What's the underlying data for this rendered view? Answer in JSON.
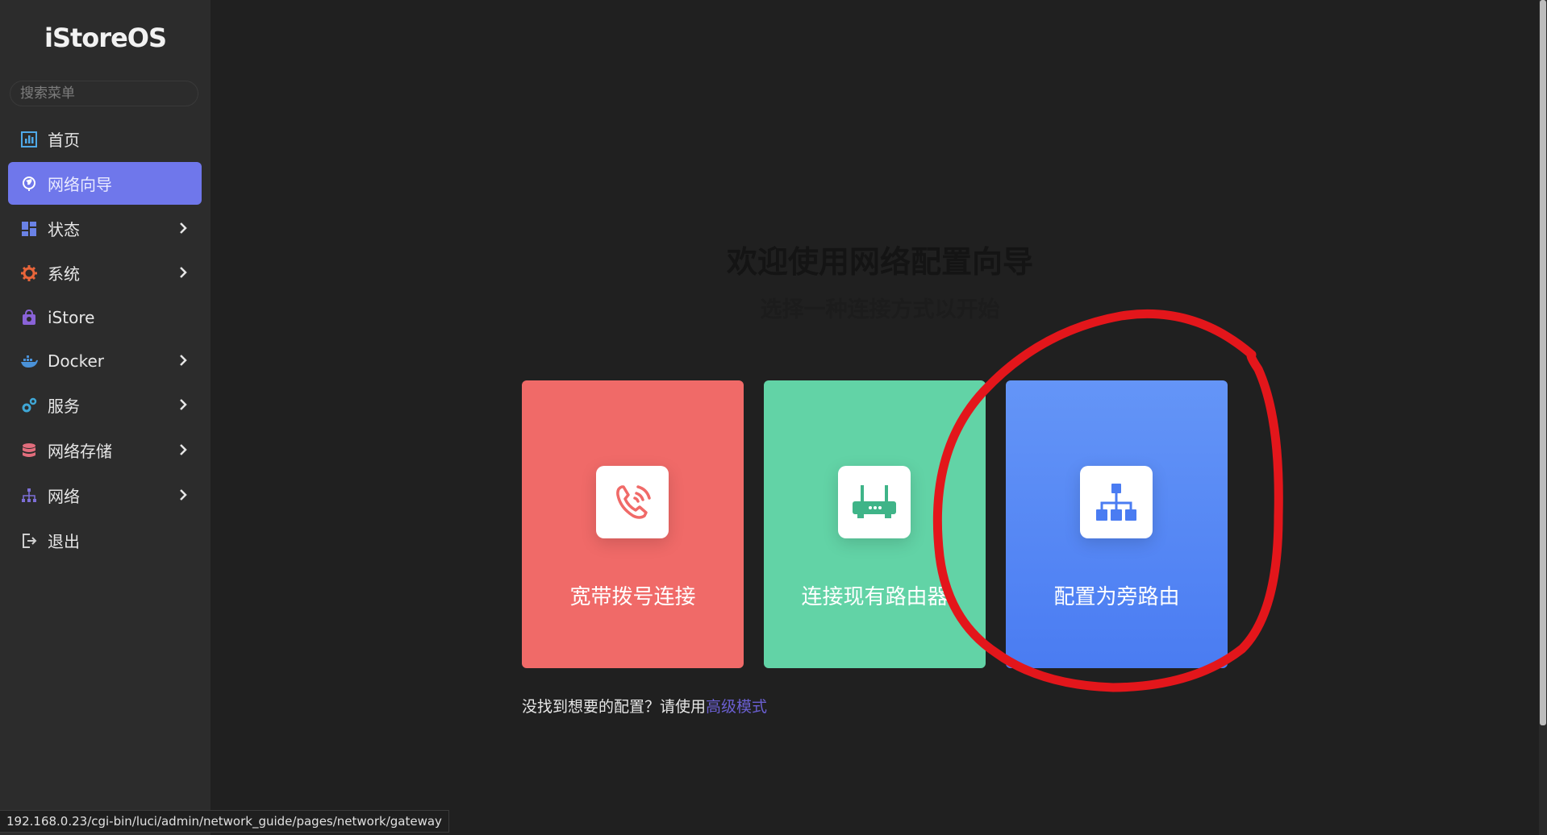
{
  "app": {
    "logo": "iStoreOS"
  },
  "search": {
    "placeholder": "搜索菜单"
  },
  "sidebar": {
    "items": [
      {
        "label": "首页",
        "icon": "dashboard-icon",
        "active": false,
        "has_submenu": false
      },
      {
        "label": "网络向导",
        "icon": "globe-icon",
        "active": true,
        "has_submenu": false
      },
      {
        "label": "状态",
        "icon": "grid-icon",
        "active": false,
        "has_submenu": true
      },
      {
        "label": "系统",
        "icon": "gear-icon",
        "active": false,
        "has_submenu": true
      },
      {
        "label": "iStore",
        "icon": "store-icon",
        "active": false,
        "has_submenu": false
      },
      {
        "label": "Docker",
        "icon": "docker-icon",
        "active": false,
        "has_submenu": true
      },
      {
        "label": "服务",
        "icon": "gears-icon",
        "active": false,
        "has_submenu": true
      },
      {
        "label": "网络存储",
        "icon": "database-icon",
        "active": false,
        "has_submenu": true
      },
      {
        "label": "网络",
        "icon": "network-icon",
        "active": false,
        "has_submenu": true
      },
      {
        "label": "退出",
        "icon": "logout-icon",
        "active": false,
        "has_submenu": false
      }
    ]
  },
  "main": {
    "title": "欢迎使用网络配置向导",
    "subtitle": "选择一种连接方式以开始",
    "cards": [
      {
        "label": "宽带拨号连接",
        "icon": "phone-icon",
        "color": "#f06a68"
      },
      {
        "label": "连接现有路由器",
        "icon": "router-icon",
        "color": "#62d3a6"
      },
      {
        "label": "配置为旁路由",
        "icon": "sitemap-icon",
        "color": "#5588f5"
      }
    ],
    "hint_text": "没找到想要的配置？请使用",
    "hint_link": "高级模式"
  },
  "status_url": "192.168.0.23/cgi-bin/luci/admin/network_guide/pages/network/gateway",
  "colors": {
    "sidebar_bg": "#2c2c2c",
    "main_bg": "#202020",
    "accent": "#6f77eb",
    "annotation": "#e3161b"
  }
}
